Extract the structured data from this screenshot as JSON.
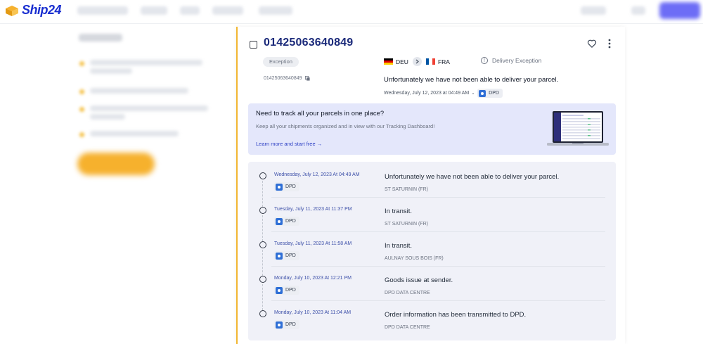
{
  "brand": {
    "logo_text": "Ship24",
    "accent": "#1a2fd0",
    "highlight": "#f2b632"
  },
  "tracking": {
    "number": "01425063640849",
    "small_number": "01425063640849",
    "badge": "Exception",
    "origin_country": "DEU",
    "destination_country": "FRA",
    "status": "Delivery Exception",
    "last_message": "Unfortunately we have not been able to deliver your parcel.",
    "last_timestamp": "Wednesday, July 12, 2023 at 04:49 AM",
    "last_carrier": "DPD"
  },
  "promo": {
    "title": "Need to track all your parcels in one place?",
    "subtitle": "Keep all your shipments organized and in view with our Tracking Dashboard!",
    "link": "Learn more and start free →"
  },
  "events": [
    {
      "date": "Wednesday, July 12, 2023 At 04:49 AM",
      "carrier": "DPD",
      "message": "Unfortunately we have not been able to deliver your parcel.",
      "location": "ST SATURNIN (FR)"
    },
    {
      "date": "Tuesday, July 11, 2023 At 11:37 PM",
      "carrier": "DPD",
      "message": "In transit.",
      "location": "ST SATURNIN (FR)"
    },
    {
      "date": "Tuesday, July 11, 2023 At 11:58 AM",
      "carrier": "DPD",
      "message": "In transit.",
      "location": "AULNAY SOUS BOIS (FR)"
    },
    {
      "date": "Monday, July 10, 2023 At 12:21 PM",
      "carrier": "DPD",
      "message": "Goods issue at sender.",
      "location": "DPD DATA CENTRE"
    },
    {
      "date": "Monday, July 10, 2023 At 11:04 AM",
      "carrier": "DPD",
      "message": "Order information has been transmitted to DPD.",
      "location": "DPD DATA CENTRE"
    }
  ]
}
